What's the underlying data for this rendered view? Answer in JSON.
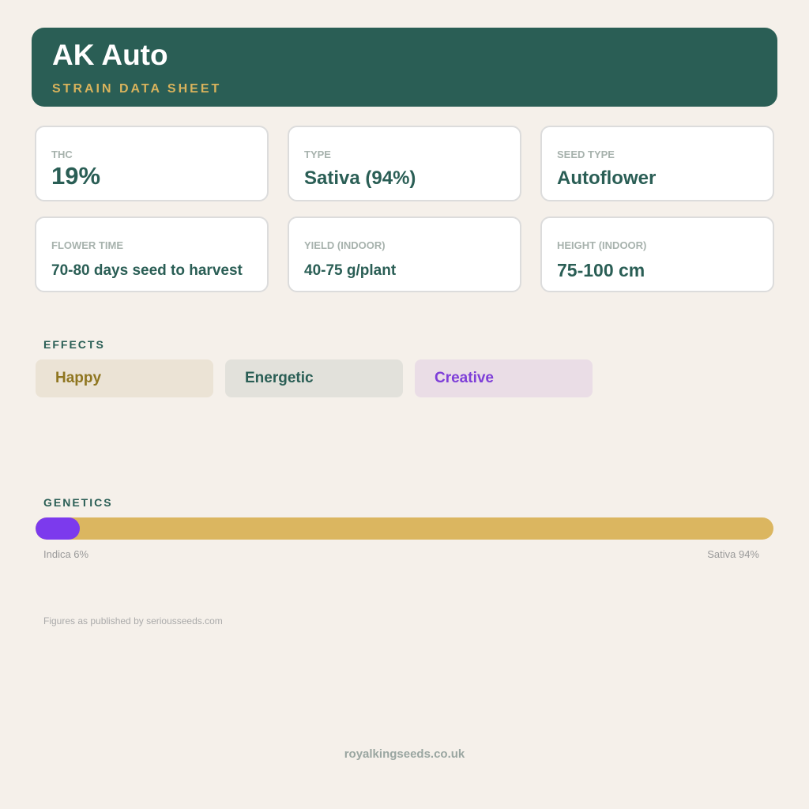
{
  "header": {
    "title": "AK Auto",
    "subtitle": "STRAIN DATA SHEET"
  },
  "stats": [
    {
      "label": "THC",
      "value": "19%"
    },
    {
      "label": "TYPE",
      "value": "Sativa (94%)"
    },
    {
      "label": "SEED TYPE",
      "value": "Autoflower"
    },
    {
      "label": "FLOWER TIME",
      "value": "70-80 days seed to harvest"
    },
    {
      "label": "YIELD (INDOOR)",
      "value": "40-75 g/plant"
    },
    {
      "label": "HEIGHT (INDOOR)",
      "value": "75-100 cm"
    }
  ],
  "effects": {
    "label": "EFFECTS",
    "items": [
      {
        "name": "Happy",
        "text_color": "#8f7620",
        "bg_color": "#ebe3d5"
      },
      {
        "name": "Energetic",
        "text_color": "#2a5e55",
        "bg_color": "#e2e1db"
      },
      {
        "name": "Creative",
        "text_color": "#7e3ed8",
        "bg_color": "#eadde6"
      }
    ]
  },
  "genetics": {
    "label": "GENETICS",
    "indica_percent": 6,
    "sativa_percent": 94,
    "indica_label": "Indica 6%",
    "sativa_label": "Sativa 94%",
    "indica_color": "#7c3aed",
    "sativa_color": "#dbb660"
  },
  "source_note": "Figures as published by seriousseeds.com",
  "footer": "royalkingseeds.co.uk",
  "colors": {
    "background": "#f5f0ea",
    "header_bg": "#2a5e55",
    "accent_gold": "#d9b35c"
  }
}
